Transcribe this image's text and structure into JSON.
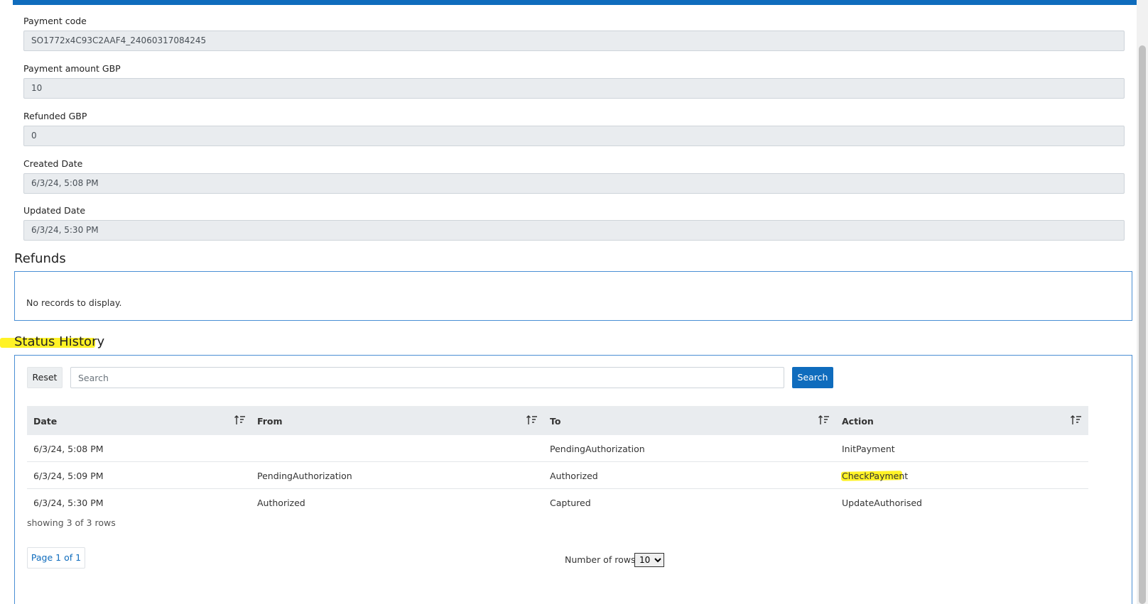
{
  "fields": [
    {
      "label": "Payment code",
      "value": "SO1772x4C93C2AAF4_24060317084245"
    },
    {
      "label": "Payment amount GBP",
      "value": "10"
    },
    {
      "label": "Refunded GBP",
      "value": "0"
    },
    {
      "label": "Created Date",
      "value": "6/3/24, 5:08 PM"
    },
    {
      "label": "Updated Date",
      "value": "6/3/24, 5:30 PM"
    }
  ],
  "refunds": {
    "title": "Refunds",
    "empty_message": "No records to display."
  },
  "status_history": {
    "title": "Status History",
    "reset_label": "Reset",
    "search_placeholder": "Search",
    "search_label": "Search",
    "columns": [
      "Date",
      "From",
      "To",
      "Action"
    ],
    "rows": [
      {
        "date": "6/3/24, 5:08 PM",
        "from": "",
        "to": "PendingAuthorization",
        "action": "InitPayment"
      },
      {
        "date": "6/3/24, 5:09 PM",
        "from": "PendingAuthorization",
        "to": "Authorized",
        "action": "CheckPayment"
      },
      {
        "date": "6/3/24, 5:30 PM",
        "from": "Authorized",
        "to": "Captured",
        "action": "UpdateAuthorised"
      }
    ],
    "showing_text": "showing 3 of 3 rows",
    "page_text": "Page 1 of 1",
    "rows_label": "Number of rows:",
    "rows_value": "10"
  },
  "colors": {
    "accent": "#0f6cbd",
    "highlight": "#fff000",
    "panel_border": "#4a8fd4"
  }
}
